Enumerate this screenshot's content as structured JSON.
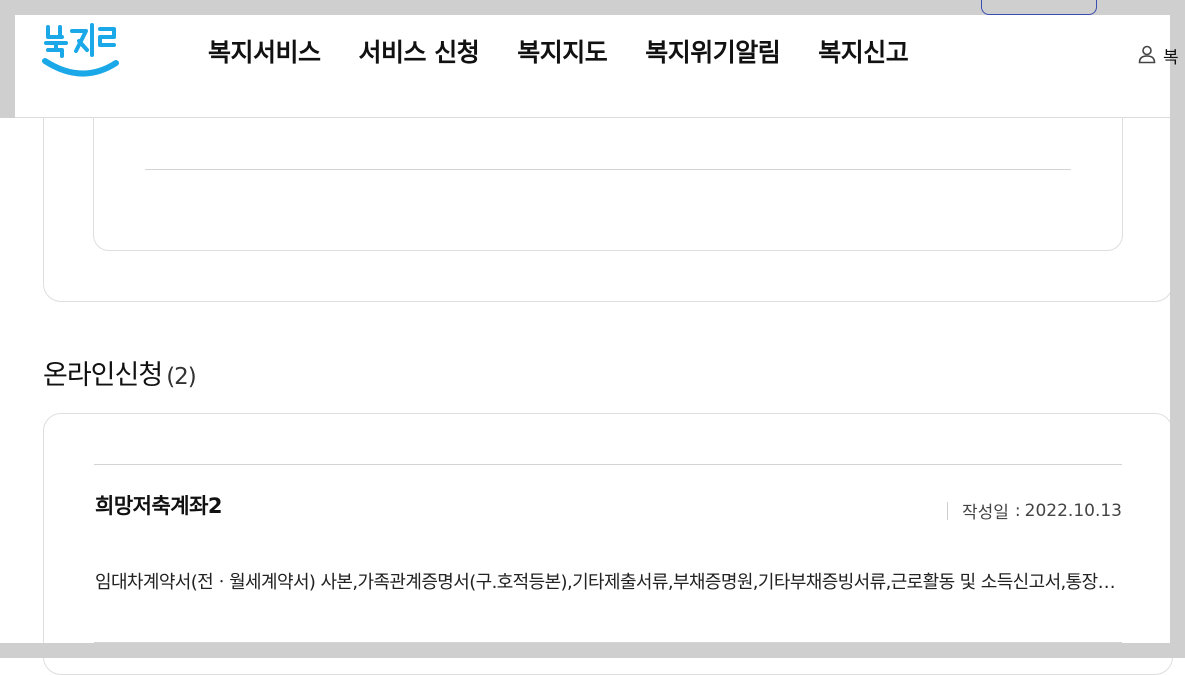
{
  "header": {
    "logo_text": "복지로",
    "nav": [
      {
        "label": "복지서비스"
      },
      {
        "label": "서비스 신청"
      },
      {
        "label": "복지지도"
      },
      {
        "label": "복지위기알림"
      },
      {
        "label": "복지신고"
      }
    ],
    "user_label": "복"
  },
  "section": {
    "title": "온라인신청",
    "count": "(2)"
  },
  "items": [
    {
      "title": "희망저축계좌2",
      "date_label": "작성일",
      "date_colon": ":",
      "date": "2022.10.13",
      "desc": "임대차계약서(전ㆍ월세계약서) 사본,가족관계증명서(구.호적등본),기타제출서류,부채증명원,기타부채증빙서류,근로활동 및 소득신고서,통장사본,금융정보등제공동의서"
    }
  ],
  "colors": {
    "logo_blue": "#1aa8e8",
    "frame_gray": "#cfcfcf",
    "border": "#dedede"
  }
}
